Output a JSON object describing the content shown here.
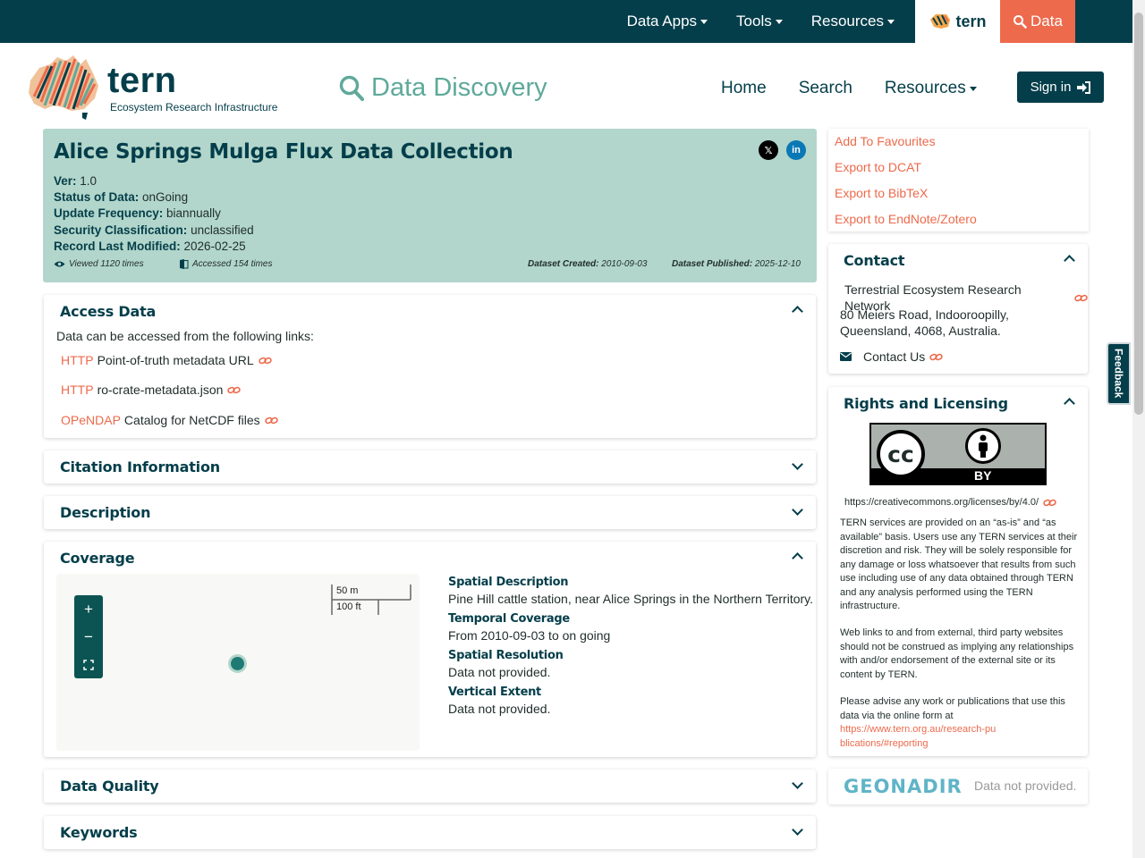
{
  "topbar": {
    "items": [
      "Data Apps",
      "Tools",
      "Resources"
    ],
    "tern_label": "tern",
    "data_label": "Data"
  },
  "header": {
    "logo_word": "tern",
    "logo_sub": "Ecosystem Research Infrastructure",
    "title": "Data Discovery",
    "nav": [
      "Home",
      "Search",
      "Resources"
    ],
    "signin": "Sign in"
  },
  "record": {
    "title": "Alice Springs Mulga Flux Data Collection",
    "meta": [
      {
        "label": "Ver:",
        "value": "1.0"
      },
      {
        "label": "Status of Data:",
        "value": "onGoing"
      },
      {
        "label": "Update Frequency:",
        "value": "biannually"
      },
      {
        "label": "Security Classification:",
        "value": "unclassified"
      },
      {
        "label": "Record Last Modified:",
        "value": "2026-02-25"
      }
    ],
    "viewed": "Viewed 1120 times",
    "accessed": "Accessed 154 times",
    "created_label": "Dataset Created:",
    "created": "2010-09-03",
    "published_label": "Dataset Published:",
    "published": "2025-12-10"
  },
  "access": {
    "title": "Access Data",
    "intro": "Data can be accessed from the following links:",
    "links": [
      {
        "proto": "HTTP",
        "text": "Point-of-truth metadata URL"
      },
      {
        "proto": "HTTP",
        "text": "ro-crate-metadata.json"
      },
      {
        "proto": "OPeNDAP",
        "text": "Catalog for NetCDF files"
      }
    ]
  },
  "sections": {
    "citation": "Citation Information",
    "description": "Description",
    "coverage": "Coverage",
    "quality": "Data Quality",
    "keywords": "Keywords"
  },
  "coverage": {
    "scale_m": "50 m",
    "scale_ft": "100 ft",
    "zoom_in": "+",
    "zoom_out": "−",
    "items": [
      {
        "label": "Spatial Description",
        "value": "Pine Hill cattle station, near Alice Springs in the Northern Territory."
      },
      {
        "label": "Temporal Coverage",
        "value": "From 2010-09-03 to on going"
      },
      {
        "label": "Spatial Resolution",
        "value": "Data not provided."
      },
      {
        "label": "Vertical Extent",
        "value": "Data not provided."
      }
    ]
  },
  "actions": [
    "Add To Favourites",
    "Export to DCAT",
    "Export to BibTeX",
    "Export to EndNote/Zotero"
  ],
  "contact": {
    "title": "Contact",
    "org": "Terrestrial Ecosystem Research Network",
    "address": "80 Meiers Road, Indooroopilly, Queensland, 4068, Australia.",
    "contact_us": "Contact Us"
  },
  "rights": {
    "title": "Rights and Licensing",
    "license_url": "https://creativecommons.org/licenses/by/4.0/",
    "badge_cc": "cc",
    "badge_by": "BY",
    "p1": "TERN services are provided on an “as-is” and “as available” basis. Users use any TERN services at their discretion and risk. They will be solely responsible for any damage or loss whatsoever that results from such use including use of any data obtained through TERN and any analysis performed using the TERN infrastructure.",
    "p2": "Web links to and from external, third party websites should not be construed as implying any relationships with and/or endorsement of the external site or its content by TERN.",
    "p3": "Please advise any work or publications that use this data via the online form at",
    "p3_link": "https://www.tern.org.au/research-publications/#reporting"
  },
  "geonadir": {
    "brand": "GEONADIR",
    "text": "Data not provided."
  },
  "feedback": "Feedback",
  "colors": {
    "brand_dark": "#043e4a",
    "accent_orange": "#ed6a4c",
    "hero_bg": "#b2d6cb",
    "teal_light": "#5fa99a"
  }
}
